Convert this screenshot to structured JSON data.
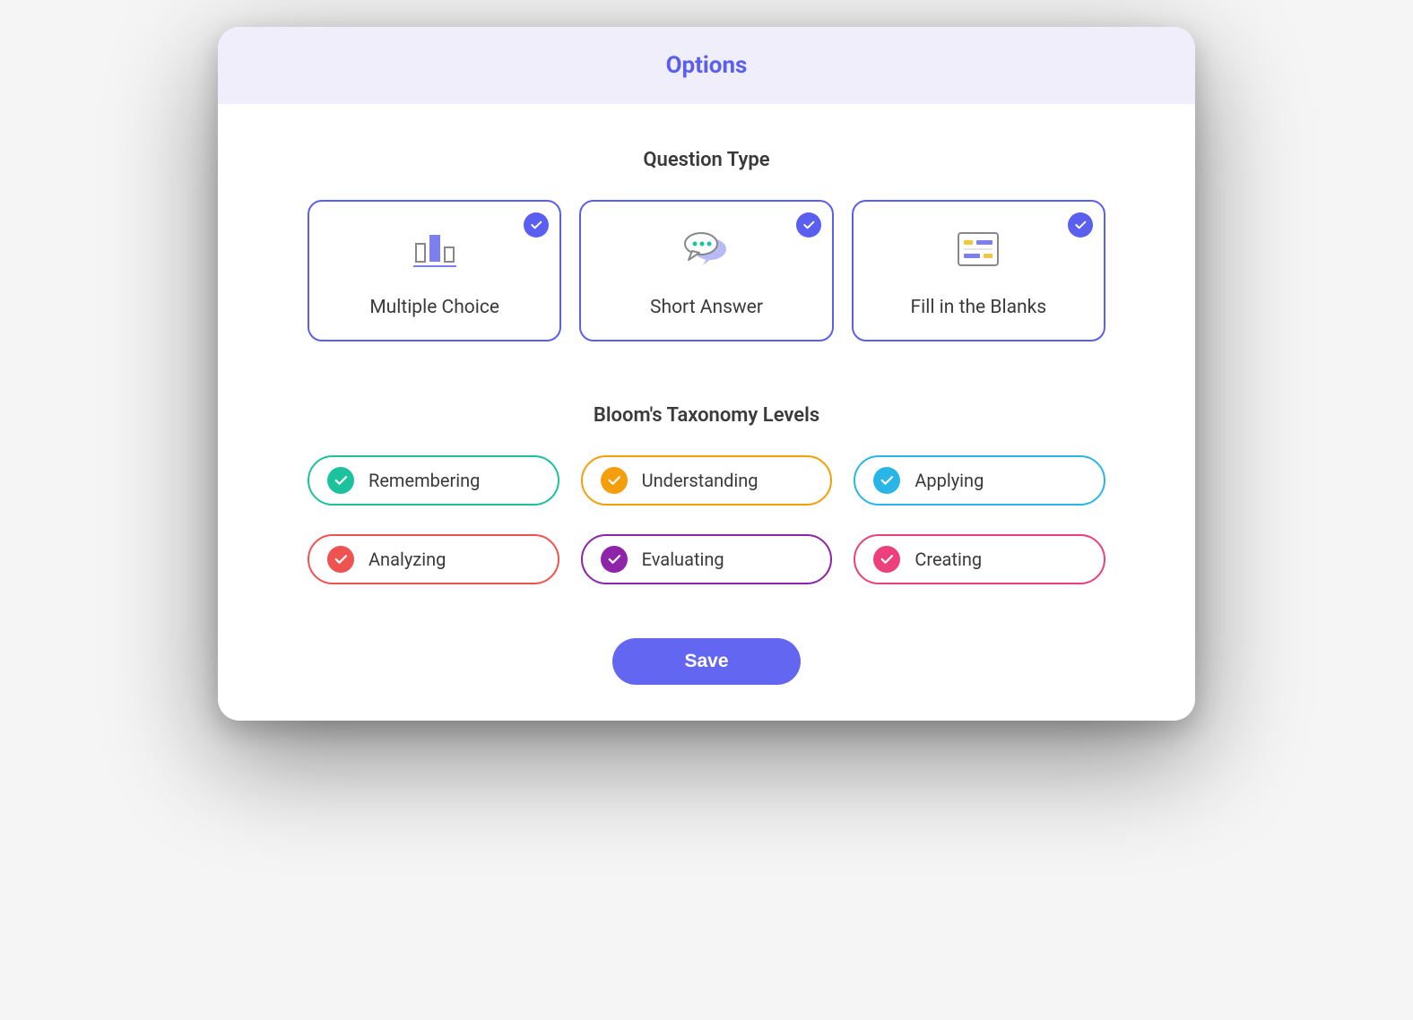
{
  "header": {
    "title": "Options"
  },
  "sections": {
    "question_type": {
      "title": "Question Type",
      "items": [
        {
          "label": "Multiple Choice",
          "selected": true,
          "icon": "bar-chart-icon"
        },
        {
          "label": "Short Answer",
          "selected": true,
          "icon": "speech-bubbles-icon"
        },
        {
          "label": "Fill in the Blanks",
          "selected": true,
          "icon": "form-fields-icon"
        }
      ]
    },
    "bloom": {
      "title": "Bloom's Taxonomy Levels",
      "items": [
        {
          "label": "Remembering",
          "color": "#1bc29b",
          "selected": true
        },
        {
          "label": "Understanding",
          "color": "#f59e0b",
          "selected": true
        },
        {
          "label": "Applying",
          "color": "#29b6e6",
          "selected": true
        },
        {
          "label": "Analyzing",
          "color": "#ef5350",
          "selected": true
        },
        {
          "label": "Evaluating",
          "color": "#8e24aa",
          "selected": true
        },
        {
          "label": "Creating",
          "color": "#ec407a",
          "selected": true
        }
      ]
    }
  },
  "actions": {
    "save_label": "Save"
  },
  "colors": {
    "accent": "#5b5fef",
    "header_bg": "#f0eefa"
  }
}
